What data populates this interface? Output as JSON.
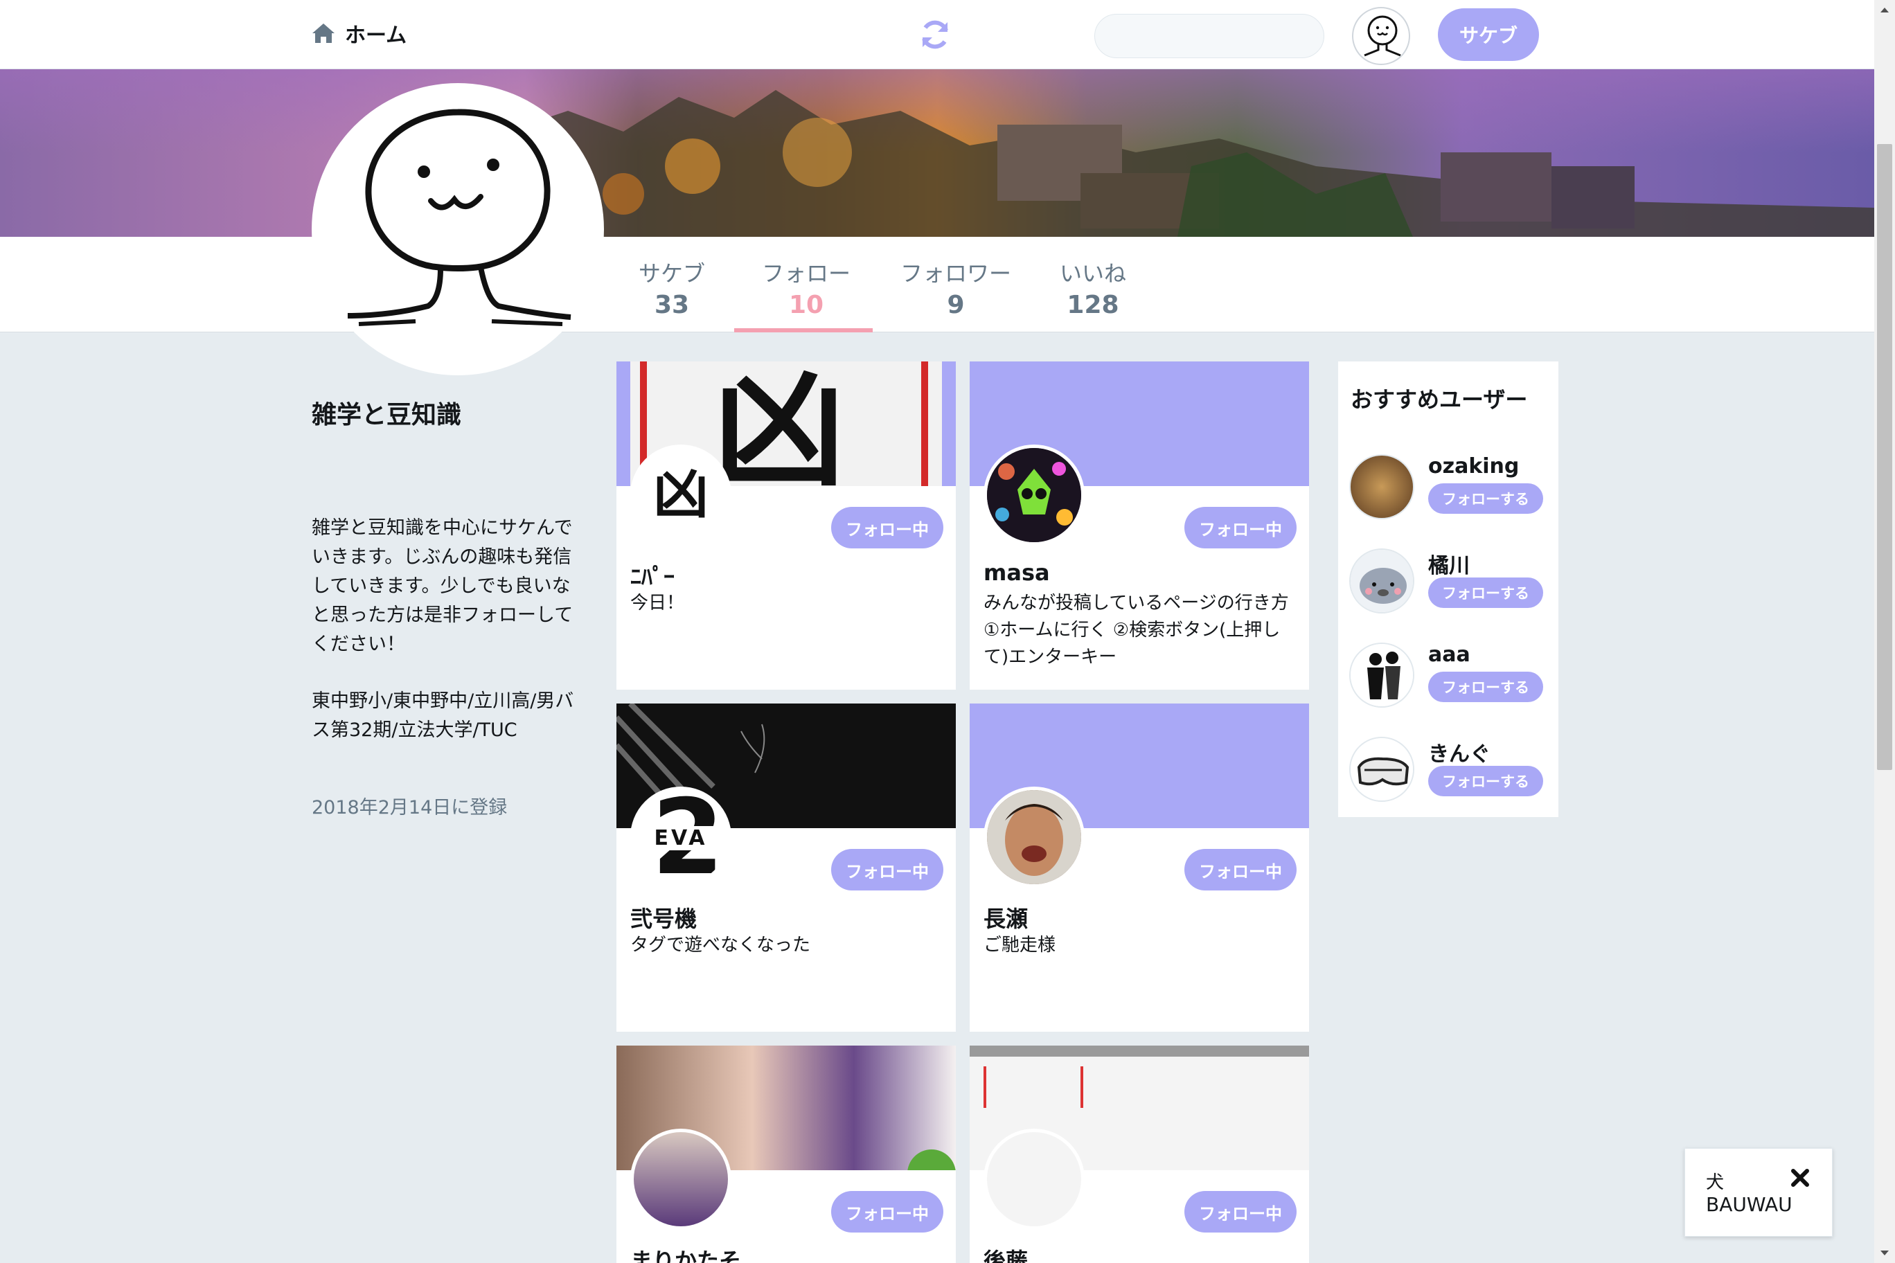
{
  "header": {
    "home_label": "ホーム",
    "search_placeholder": "",
    "post_button": "サケブ"
  },
  "profile": {
    "stats": [
      {
        "label": "サケブ",
        "value": "33"
      },
      {
        "label": "フォロー",
        "value": "10"
      },
      {
        "label": "フォロワー",
        "value": "9"
      },
      {
        "label": "いいね",
        "value": "128"
      }
    ],
    "active_tab": "フォロー",
    "name": "雑学と豆知識",
    "bio": "雑学と豆知識を中心にサケんでいきます。じぶんの趣味も発信していきます。少しでも良いなと思った方は是非フォローしてください！",
    "school": "東中野小/東中野中/立川高/男バス第32期/立法大学/TUC",
    "joined": "2018年2月14日に登録"
  },
  "following_cards": [
    {
      "name": "ﾆﾊﾟｰ",
      "description": "今日！",
      "button": "フォロー中"
    },
    {
      "name": "masa",
      "description": "みんなが投稿しているページの行き方①ホームに行く ②検索ボタン(上押して)エンターキー",
      "button": "フォロー中"
    },
    {
      "name": "弐号機",
      "description": "タグで遊べなくなった",
      "button": "フォロー中"
    },
    {
      "name": "長瀬",
      "description": "ご馳走様",
      "button": "フォロー中"
    },
    {
      "name": "まりかたそ",
      "description": "",
      "button": "フォロー中"
    },
    {
      "name": "後藤",
      "description": "",
      "button": "フォロー中"
    }
  ],
  "card_image_text": {
    "kanji": "凶",
    "eva_text": "EVA",
    "eva_number": "2"
  },
  "recommended": {
    "title": "おすすめユーザー",
    "users": [
      {
        "name": "ozaking",
        "button": "フォローする"
      },
      {
        "name": "橘川",
        "button": "フォローする"
      },
      {
        "name": "aaa",
        "button": "フォローする"
      },
      {
        "name": "きんぐ",
        "button": "フォローする"
      }
    ]
  },
  "toast": {
    "title": "犬",
    "text": "BAUWAU"
  },
  "colors": {
    "accent": "#a9a8f6",
    "active_tab": "#f4a0b0",
    "page_bg": "#e6ecf0"
  }
}
